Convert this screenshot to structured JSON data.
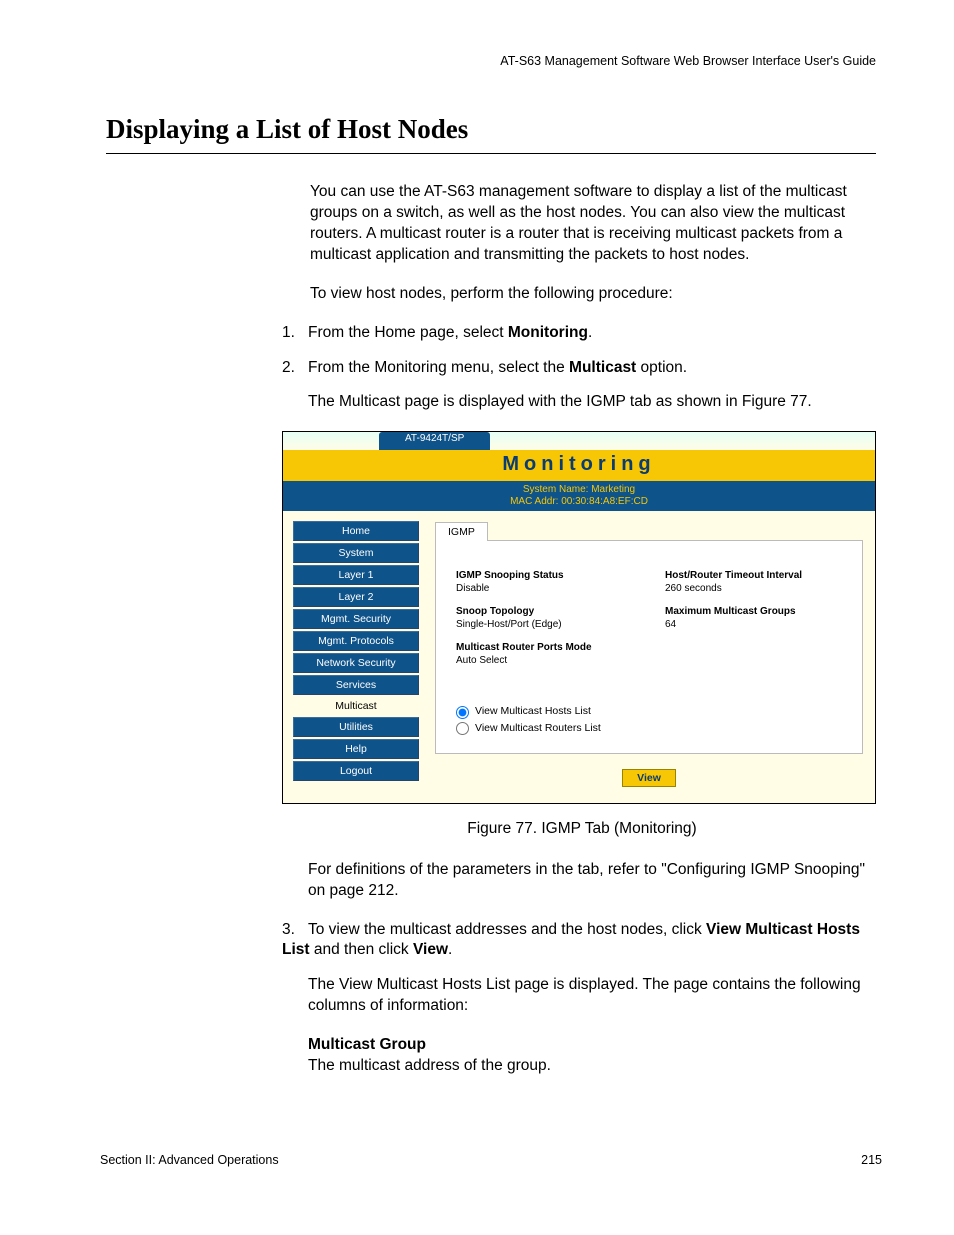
{
  "doc_header": "AT-S63 Management Software Web Browser Interface User's Guide",
  "heading": "Displaying a List of Host Nodes",
  "intro": "You can use the AT-S63 management software to display a list of the multicast groups on a switch, as well as the host nodes. You can also view the multicast routers. A multicast router is a router that is receiving multicast packets from a multicast application and transmitting the packets to host nodes.",
  "lead_in": "To view host nodes, perform the following procedure:",
  "steps": {
    "s1_pre": "From the Home page, select ",
    "s1_b": "Monitoring",
    "s1_post": ".",
    "s2_pre": "From the Monitoring menu, select the ",
    "s2_b": "Multicast",
    "s2_post": " option.",
    "s2_sub": "The Multicast page is displayed with the IGMP tab as shown in Figure 77.",
    "s3_pre": "To view the multicast addresses and the host nodes, click ",
    "s3_b1": "View Multicast Hosts List",
    "s3_mid": " and then click ",
    "s3_b2": "View",
    "s3_post": ".",
    "s3_sub1": "The View Multicast Hosts List page is displayed. The page contains the following columns of information:",
    "s3_sub_h": "Multicast Group",
    "s3_sub2": "The multicast address of the group."
  },
  "fig_caption": "Figure 77. IGMP Tab (Monitoring)",
  "after_fig": "For definitions of the parameters in the tab, refer to \"Configuring IGMP Snooping\" on page 212.",
  "footer_left": "Section II: Advanced Operations",
  "footer_right": "215",
  "screenshot": {
    "model": "AT-9424T/SP",
    "title": "Monitoring",
    "sys_name": "System Name: Marketing",
    "mac": "MAC Addr: 00:30:84:A8:EF:CD",
    "nav": [
      "Home",
      "System",
      "Layer 1",
      "Layer 2",
      "Mgmt. Security",
      "Mgmt. Protocols",
      "Network Security",
      "Services"
    ],
    "nav_plain": "Multicast",
    "nav2": [
      "Utilities",
      "Help",
      "Logout"
    ],
    "tab": "IGMP",
    "left_col": [
      {
        "h": "IGMP Snooping Status",
        "v": "Disable"
      },
      {
        "h": "Snoop Topology",
        "v": "Single-Host/Port (Edge)"
      },
      {
        "h": "Multicast Router Ports Mode",
        "v": "Auto Select"
      }
    ],
    "right_col": [
      {
        "h": "Host/Router Timeout Interval",
        "v": "260 seconds"
      },
      {
        "h": "Maximum Multicast Groups",
        "v": "64"
      }
    ],
    "radio1": "View Multicast Hosts List",
    "radio2": "View Multicast Routers List",
    "view_btn": "View"
  }
}
